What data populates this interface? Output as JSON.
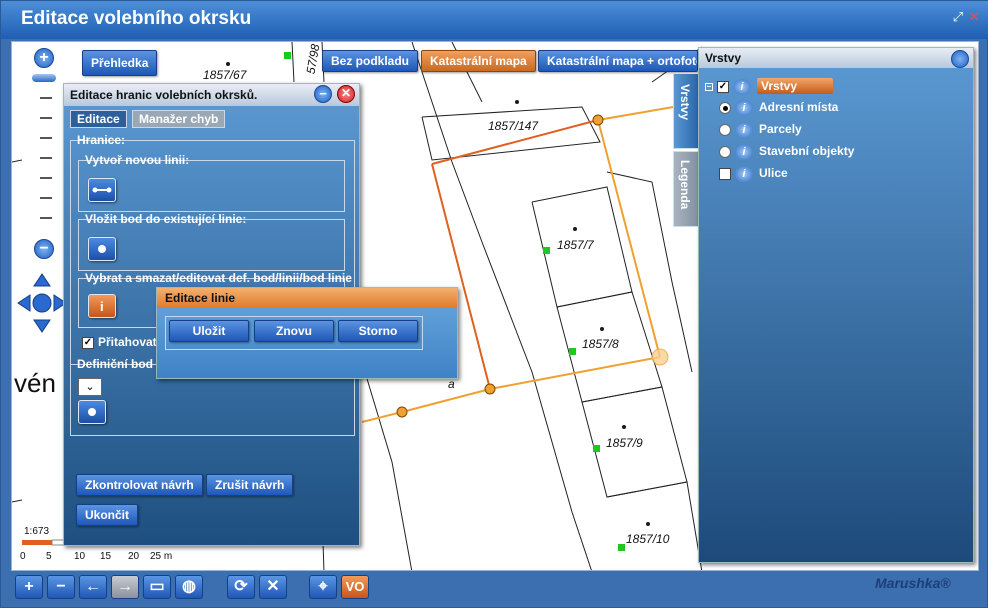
{
  "window": {
    "title": "Editace volebního okrsku"
  },
  "map": {
    "top_buttons": [
      "Přehledka",
      "Bez podkladu",
      "Katastrální mapa",
      "Katastrální mapa + ortofoto"
    ],
    "active_basemap": "Katastrální mapa",
    "parcel_labels": [
      "1857/67",
      "57/98",
      "1857/147",
      "1857/7",
      "1857/8",
      "1857/9",
      "1857/10"
    ],
    "partial_text": "vén",
    "partial_letter": "a",
    "scale": {
      "ratio": "1:673",
      "ticks": [
        "0",
        "5",
        "10",
        "15",
        "20",
        "25 m"
      ]
    }
  },
  "edit_panel": {
    "title": "Editace hranic volebních okrsků.",
    "tabs": [
      "Editace",
      "Manažer chyb"
    ],
    "active_tab": "Editace",
    "section_label": "Hranice:",
    "groups": [
      "Vytvoř novou linii:",
      "Vložit bod do existující linie:",
      "Vybrat a smazat/editovat def. bod/linii/bod linie"
    ],
    "snap_label": "Přitahovat",
    "snap_checked": true,
    "def_points_label": "Definiční bod",
    "buttons": {
      "check": "Zkontrolovat návrh",
      "cancel": "Zrušit návrh",
      "finish": "Ukončit"
    }
  },
  "line_dialog": {
    "title": "Editace linie",
    "buttons": [
      "Uložit",
      "Znovu",
      "Storno"
    ]
  },
  "layers_panel": {
    "title": "Vrstvy",
    "side_tabs": [
      "Vrstvy",
      "Legenda"
    ],
    "root": {
      "label": "Vrstvy",
      "checked": true
    },
    "items": [
      {
        "label": "Adresní místa",
        "control": "radio",
        "selected": true
      },
      {
        "label": "Parcely",
        "control": "radio",
        "selected": false
      },
      {
        "label": "Stavební objekty",
        "control": "radio",
        "selected": false
      },
      {
        "label": "Ulice",
        "control": "checkbox",
        "selected": false
      }
    ]
  },
  "toolbar": {
    "tools": [
      "zoom-in",
      "zoom-out",
      "back",
      "forward",
      "zoom-box",
      "pan-globe",
      "refresh",
      "clear",
      "locate",
      "vo"
    ],
    "vo_label": "VO"
  },
  "brand": "Marushka®",
  "colors": {
    "accent": "#1f5eb3",
    "orange": "#e8872a",
    "boundary": "#f0a030"
  }
}
